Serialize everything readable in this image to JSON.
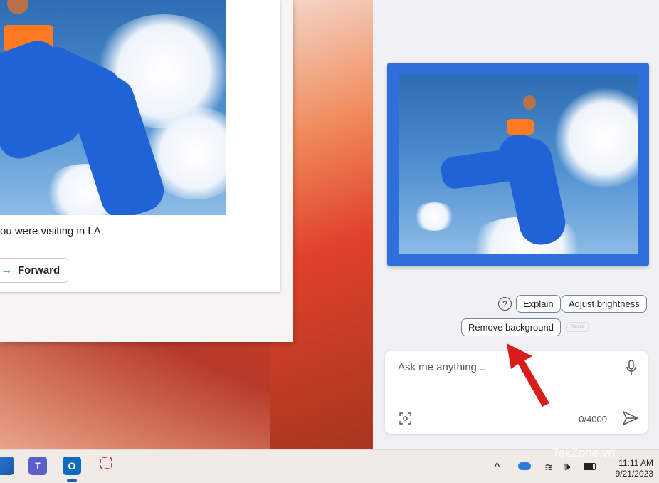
{
  "email": {
    "message_text": "ou were visiting in LA.",
    "forward_label": "Forward"
  },
  "copilot": {
    "suggestions": [
      "Explain",
      "Adjust brightness",
      "Remove background"
    ],
    "resize_label": "Resize",
    "input_placeholder": "Ask me anything...",
    "char_count": "0/4000"
  },
  "taskbar": {
    "apps": [
      "microsoft-store",
      "teams",
      "outlook",
      "snipping-tool"
    ],
    "time": "11:11 AM",
    "date": "9/21/2023"
  },
  "watermark": "TekZone.vn",
  "colors": {
    "accent": "#2f6fdc",
    "arrow": "#d91c1c"
  }
}
